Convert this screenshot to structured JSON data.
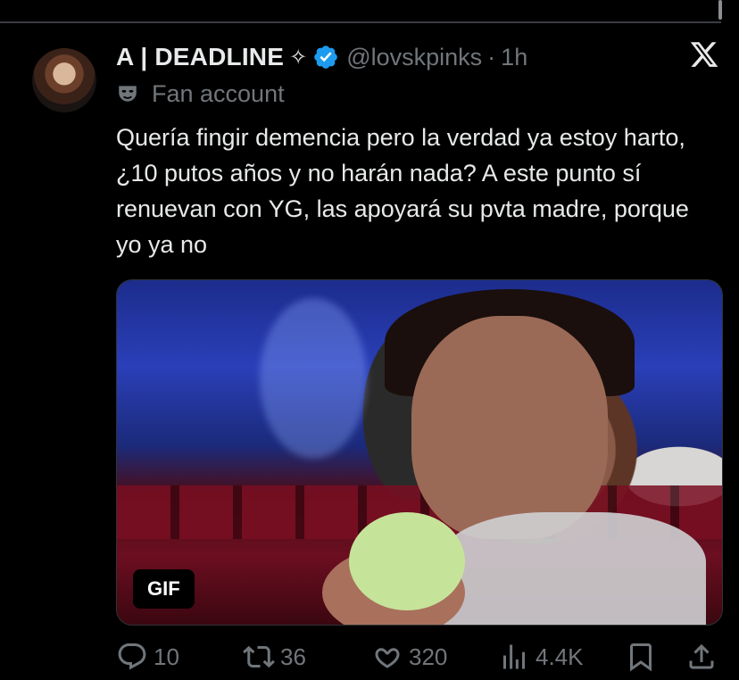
{
  "tweet": {
    "display_name": "A | DEADLINE",
    "name_badge_symbol": "✧",
    "handle": "@lovskpinks",
    "separator": "·",
    "time": "1h",
    "label": "Fan account",
    "text": "Quería fingir demencia pero la verdad ya estoy harto, ¿10 putos años y no harán nada? A este punto sí renuevan con YG, las apoyará su pvta madre, porque yo ya no",
    "media": {
      "badge": "GIF"
    },
    "actions": {
      "replies": "10",
      "reposts": "36",
      "likes": "320",
      "views": "4.4K"
    }
  },
  "colors": {
    "background": "#000000",
    "text_primary": "#e7e9ea",
    "text_secondary": "#71767b",
    "verified_badge": "#1d9bf0"
  },
  "icons": [
    "sparkle-icon",
    "verified-badge-icon",
    "x-logo-icon",
    "fan-account-mask-icon",
    "reply-icon",
    "repost-icon",
    "like-icon",
    "views-icon",
    "bookmark-icon",
    "share-icon"
  ]
}
